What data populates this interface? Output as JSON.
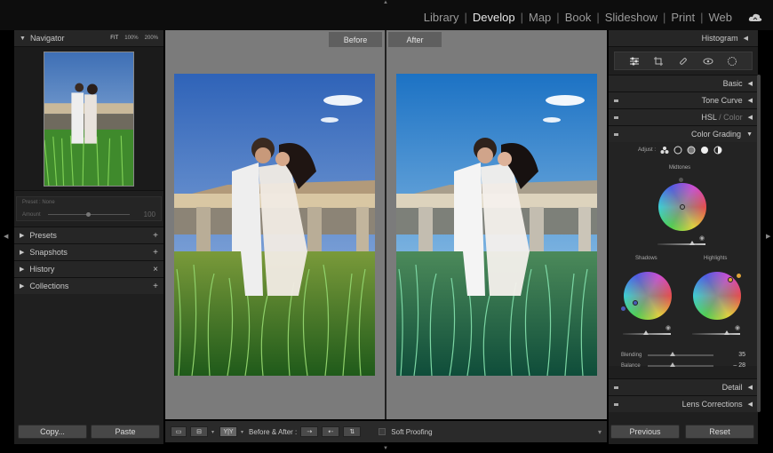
{
  "modules": [
    "Library",
    "Develop",
    "Map",
    "Book",
    "Slideshow",
    "Print",
    "Web"
  ],
  "active_module": "Develop",
  "navigator": {
    "title": "Navigator",
    "zoom_levels": [
      "FIT",
      "100%",
      "200%"
    ]
  },
  "preset": {
    "label": "Preset : None",
    "amount_label": "Amount",
    "amount_value": "100",
    "amount_fraction": 0.5
  },
  "left_sections": [
    {
      "label": "Presets",
      "action": "+"
    },
    {
      "label": "Snapshots",
      "action": "+"
    },
    {
      "label": "History",
      "action": "×"
    },
    {
      "label": "Collections",
      "action": "+"
    }
  ],
  "buttons": {
    "copy": "Copy...",
    "paste": "Paste",
    "previous": "Previous",
    "reset": "Reset"
  },
  "view": {
    "before": "Before",
    "after": "After"
  },
  "toolbar": {
    "before_after": "Before & After :",
    "soft_proofing": "Soft Proofing",
    "yy_label": "Y|Y"
  },
  "right_sections_top": [
    {
      "label": "Histogram"
    },
    {
      "label": "Basic"
    },
    {
      "label": "Tone Curve"
    },
    {
      "label": "HSL",
      "suffix": "Color"
    }
  ],
  "color_grading": {
    "title": "Color Grading",
    "adjust_label": "Adjust :",
    "midtones_label": "Midtones",
    "shadows_label": "Shadows",
    "highlights_label": "Highlights",
    "blending_label": "Blending",
    "blending_value": "35",
    "balance_label": "Balance",
    "balance_value": "– 28"
  },
  "right_sections_bottom": [
    {
      "label": "Detail"
    },
    {
      "label": "Lens Corrections"
    }
  ]
}
